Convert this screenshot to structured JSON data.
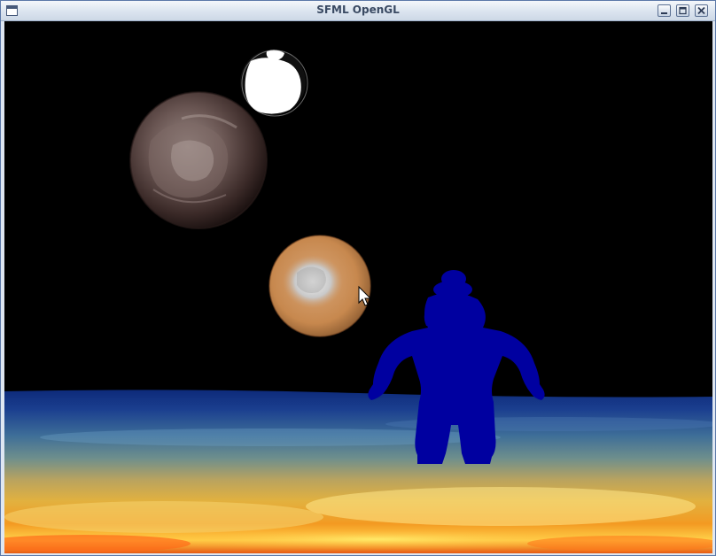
{
  "window": {
    "title": "SFML OpenGL",
    "app_icon": "window-icon",
    "controls": {
      "minimize_icon": "minimize-icon",
      "maximize_icon": "maximize-icon",
      "close_icon": "close-icon"
    }
  },
  "scene": {
    "background_color": "#000000",
    "figure_color": "#0000a0",
    "objects": [
      "white-moon",
      "brown-planet",
      "mars-planet",
      "blue-figure",
      "lava-ground",
      "mouse-cursor"
    ]
  }
}
